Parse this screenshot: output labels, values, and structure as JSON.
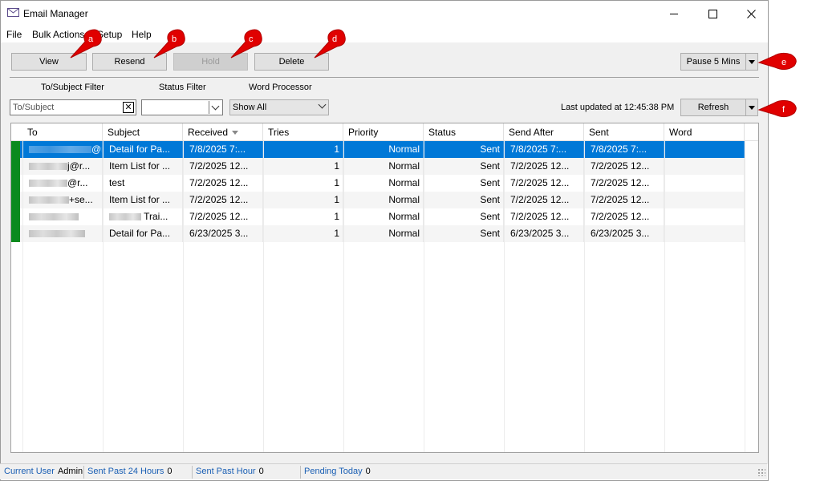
{
  "window": {
    "title": "Email Manager"
  },
  "menu": [
    "File",
    "Bulk Actions",
    "Setup",
    "Help"
  ],
  "toolbar": {
    "view_label": "View",
    "resend_label": "Resend",
    "hold_label": "Hold",
    "delete_label": "Delete",
    "pause_label": "Pause 5 Mins",
    "refresh_label": "Refresh"
  },
  "filters": {
    "subject_label": "To/Subject Filter",
    "subject_placeholder": "To/Subject",
    "status_label": "Status Filter",
    "status_value": "",
    "wp_label": "Word Processor",
    "wp_value": "Show All"
  },
  "last_updated": "Last updated at 12:45:38 PM",
  "grid": {
    "columns": [
      "To",
      "Subject",
      "Received",
      "Tries",
      "Priority",
      "Status",
      "Send After",
      "Sent",
      "Word"
    ],
    "rows": [
      {
        "to": "@r...",
        "subject": "Detail for Pa...",
        "received": "7/8/2025 7:...",
        "tries": "1",
        "priority": "Normal",
        "status": "Sent",
        "send_after": "7/8/2025 7:...",
        "sent": "7/8/2025 7:...",
        "word": ""
      },
      {
        "to": "j@r...",
        "subject": "Item List for ...",
        "received": "7/2/2025 12...",
        "tries": "1",
        "priority": "Normal",
        "status": "Sent",
        "send_after": "7/2/2025 12...",
        "sent": "7/2/2025 12...",
        "word": ""
      },
      {
        "to": "@r...",
        "subject": "test",
        "received": "7/2/2025 12...",
        "tries": "1",
        "priority": "Normal",
        "status": "Sent",
        "send_after": "7/2/2025 12...",
        "sent": "7/2/2025 12...",
        "word": ""
      },
      {
        "to": "+se...",
        "subject": "Item List for ...",
        "received": "7/2/2025 12...",
        "tries": "1",
        "priority": "Normal",
        "status": "Sent",
        "send_after": "7/2/2025 12...",
        "sent": "7/2/2025 12...",
        "word": ""
      },
      {
        "to": "",
        "subject": "Trai...",
        "received": "7/2/2025 12...",
        "tries": "1",
        "priority": "Normal",
        "status": "Sent",
        "send_after": "7/2/2025 12...",
        "sent": "7/2/2025 12...",
        "word": ""
      },
      {
        "to": "",
        "subject": "Detail for Pa...",
        "received": "6/23/2025 3...",
        "tries": "1",
        "priority": "Normal",
        "status": "Sent",
        "send_after": "6/23/2025 3...",
        "sent": "6/23/2025 3...",
        "word": ""
      }
    ]
  },
  "statusbar": {
    "current_user_label": "Current User",
    "current_user_value": "Admin",
    "sent_24h_label": "Sent Past 24 Hours",
    "sent_24h_value": "0",
    "sent_hour_label": "Sent Past Hour",
    "sent_hour_value": "0",
    "pending_label": "Pending Today",
    "pending_value": "0"
  },
  "annotations": [
    "a",
    "b",
    "c",
    "d",
    "e",
    "f"
  ],
  "colors": {
    "selection": "#0078d7",
    "row_marker": "#0a8a1e",
    "annotation": "#e00000",
    "status_key": "#1a5fb4"
  },
  "icons": [
    "envelope-icon",
    "minimize-icon",
    "maximize-icon",
    "close-icon",
    "clear-icon",
    "chevron-down-icon",
    "sort-desc-icon",
    "resize-grip-icon"
  ]
}
